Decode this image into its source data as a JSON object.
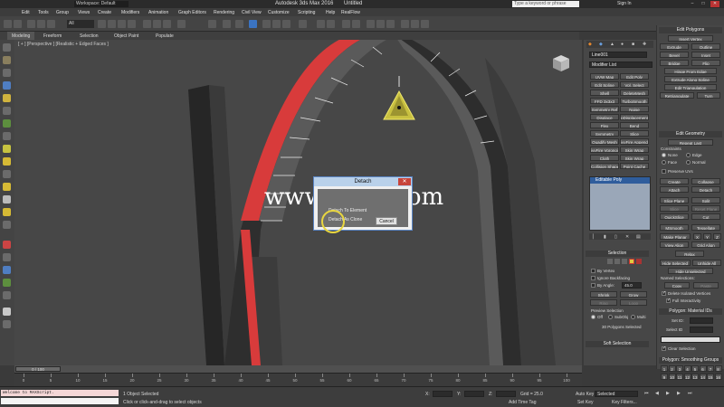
{
  "window": {
    "app_title": "Autodesk 3ds Max 2016",
    "doc_title": "Untitled",
    "workspace": "Workspace: Default",
    "search_placeholder": "Type a keyword or phrase",
    "sign_in": "Sign In"
  },
  "menu": [
    "Edit",
    "Tools",
    "Group",
    "Views",
    "Create",
    "Modifiers",
    "Animation",
    "Graph Editors",
    "Rendering",
    "Civil View",
    "Customize",
    "Scripting",
    "Help",
    "RealFlow"
  ],
  "toolbar": {
    "selection_filter": "All"
  },
  "ribbon": {
    "tabs": [
      "Modeling",
      "Freeform",
      "Selection",
      "Object Paint",
      "Populate"
    ]
  },
  "viewport": {
    "label": "[ + ] [Perspective ] [Realistic + Edged Faces ]",
    "watermark": "www.cgtsj.com"
  },
  "dialog": {
    "title": "Detach",
    "detach_to_element": "Detach To Element",
    "detach_as_clone": "Detach As Clone",
    "cancel": "Cancel"
  },
  "command_panel": {
    "object_name": "Line001",
    "modifier_list": "Modifier List",
    "modifiers": [
      [
        "UVW Map",
        "Edit Poly"
      ],
      [
        "Edit Spline",
        "Vol. Select"
      ],
      [
        "Shell",
        "DeleteMesh"
      ],
      [
        "FFD 3x3x3",
        "TurboSmooth"
      ],
      [
        "Symmetry Ref",
        "Noise"
      ],
      [
        "Displace",
        "pDisplacement"
      ],
      [
        "Flex",
        "Bend"
      ],
      [
        "Symmetry",
        "Slice"
      ],
      [
        "Quadify Mesh",
        "ivyFire Append"
      ],
      [
        "ivyFire Voronoi",
        "Skin Wrap"
      ],
      [
        "Cloth",
        "Skin Wrap"
      ],
      [
        "Collision Shape",
        "Point Cache"
      ]
    ],
    "stack_item": "Editable Poly",
    "selection_title": "Selection",
    "by_vertex": "By Vertex",
    "ignore_backfacing": "Ignore Backfacing",
    "by_angle": "By Angle:",
    "by_angle_value": "45.0",
    "shrink": "Shrink",
    "grow": "Grow",
    "ring": "Ring",
    "loop": "Loop",
    "preview_selection": "Preview Selection",
    "preview_off": "Off",
    "preview_subobj": "SubObj",
    "preview_multi": "Multi",
    "selected_count": "30 Polygons Selected",
    "soft_selection": "Soft Selection"
  },
  "right_panel": {
    "edit_polygons": "Edit Polygons",
    "insert_vertex": "Insert Vertex",
    "extrude": "Extrude",
    "outline": "Outline",
    "bevel": "Bevel",
    "inset": "Inset",
    "bridge": "Bridge",
    "flip": "Flip",
    "hinge": "Hinge From Edge",
    "extrude_spline": "Extrude Along Spline",
    "edit_triangulation": "Edit Triangulation",
    "retriangulate": "Retriangulate",
    "turn": "Turn",
    "edit_geometry": "Edit Geometry",
    "repeat_last": "Repeat Last",
    "constraints": "Constraints",
    "c_none": "None",
    "c_edge": "Edge",
    "c_face": "Face",
    "c_normal": "Normal",
    "preserve_uvs": "Preserve UVs",
    "create": "Create",
    "collapse": "Collapse",
    "attach": "Attach",
    "detach": "Detach",
    "slice_plane": "Slice Plane",
    "split": "Split",
    "slice": "Slice",
    "reset_plane": "Reset Plane",
    "quickslice": "QuickSlice",
    "cut": "Cut",
    "msmooth": "MSmooth",
    "tessellate": "Tessellate",
    "make_planar": "Make Planar",
    "x": "X",
    "y": "Y",
    "z": "Z",
    "view_align": "View Align",
    "grid_align": "Grid Align",
    "relax": "Relax",
    "hide_selected": "Hide Selected",
    "unhide_all": "Unhide All",
    "hide_unselected": "Hide Unselected",
    "named_selections": "Named Selections:",
    "copy": "Copy",
    "paste": "Paste",
    "delete_isolated": "Delete Isolated Vertices",
    "full_interactivity": "Full Interactivity",
    "material_ids": "Polygon: Material IDs",
    "set_id": "Set ID:",
    "select_id": "Select ID",
    "clear_selection": "Clear Selection",
    "smoothing_groups": "Polygon: Smoothing Groups",
    "sg_numbers": [
      "1",
      "2",
      "3",
      "4",
      "5",
      "6",
      "7",
      "8",
      "9",
      "10",
      "11",
      "12",
      "13",
      "14",
      "15",
      "16"
    ]
  },
  "timeline": {
    "frame_display": "0 / 100",
    "ticks": [
      "0",
      "5",
      "10",
      "15",
      "20",
      "25",
      "30",
      "35",
      "40",
      "45",
      "50",
      "55",
      "60",
      "65",
      "70",
      "75",
      "80",
      "85",
      "90",
      "95",
      "100"
    ]
  },
  "status": {
    "maxscript": "Welcome to MAXScript.",
    "objects_selected": "1 Object Selected",
    "prompt": "Click or click-and-drag to select objects",
    "x_label": "X:",
    "y_label": "Y:",
    "z_label": "Z:",
    "grid": "Grid = 25.0",
    "add_time_tag": "Add Time Tag",
    "auto_key": "Auto Key",
    "selected": "Selected",
    "set_key": "Set Key",
    "key_filters": "Key Filters..."
  }
}
